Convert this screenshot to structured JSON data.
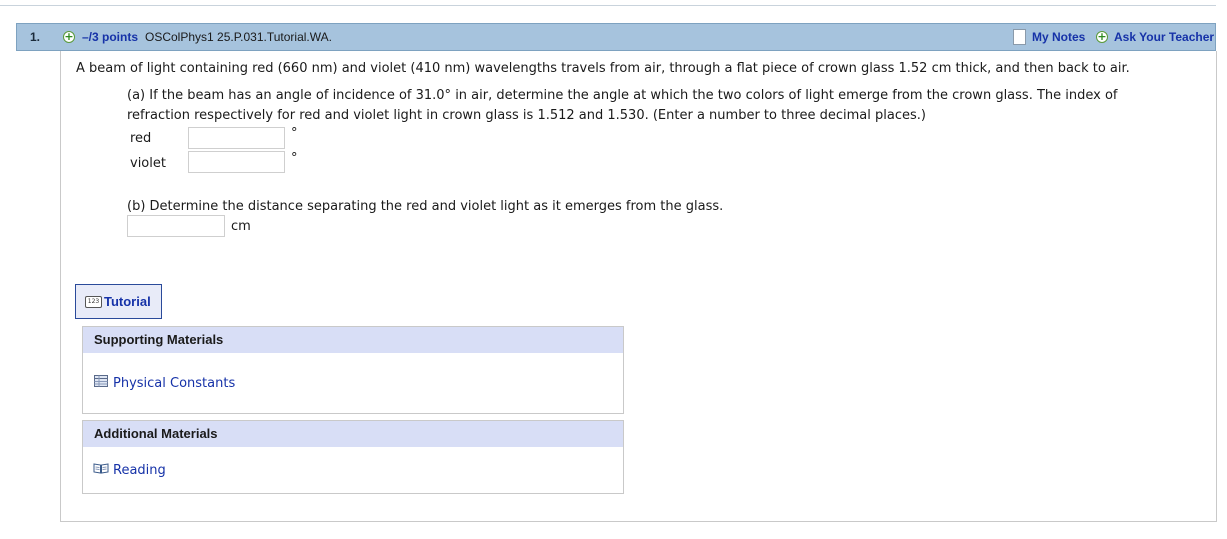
{
  "question": {
    "number": "1.",
    "points": "–/3 points",
    "assignment_id": "OSColPhys1 25.P.031.Tutorial.WA.",
    "my_notes": "My Notes",
    "ask_teacher": "Ask Your Teacher",
    "intro": "A beam of light containing red (660 nm) and violet (410 nm) wavelengths travels from air, through a flat piece of crown glass 1.52 cm thick, and then back to air.",
    "part_a_line1": "(a) If the beam has an angle of incidence of 31.0° in air, determine the angle at which the two colors of light emerge from the crown glass. The index of",
    "part_a_line2": "refraction respectively for red and violet light in crown glass is 1.512 and 1.530. (Enter a number to three decimal places.)",
    "red_label": "red",
    "violet_label": "violet",
    "degree_unit": "°",
    "red_value": "",
    "violet_value": "",
    "part_b": "(b) Determine the distance separating the red and violet light as it emerges from the glass.",
    "distance_value": "",
    "distance_unit": "cm"
  },
  "tutorial": {
    "label": "Tutorial",
    "icon": "123-badge-icon"
  },
  "supporting_materials": {
    "title": "Supporting Materials",
    "links": [
      {
        "label": "Physical Constants",
        "icon": "table-icon"
      }
    ]
  },
  "additional_materials": {
    "title": "Additional Materials",
    "links": [
      {
        "label": "Reading",
        "icon": "book-icon"
      }
    ]
  },
  "colors": {
    "header_bg": "#a6c3dd",
    "link": "#1632a8",
    "panel_head_bg": "#d8def6"
  }
}
